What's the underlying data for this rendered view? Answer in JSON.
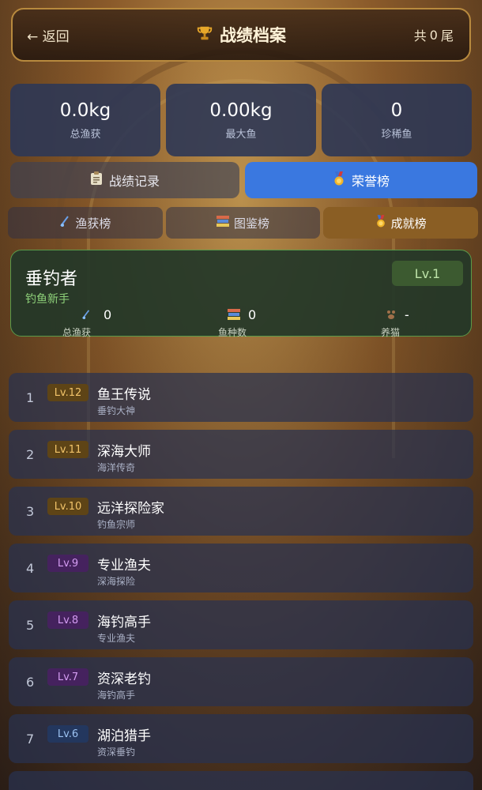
{
  "header": {
    "back_label": "← 返回",
    "title": "战绩档案",
    "count_prefix": "共",
    "count_value": "0",
    "count_suffix": "尾"
  },
  "stats": [
    {
      "value": "0.0kg",
      "label": "总渔获"
    },
    {
      "value": "0.00kg",
      "label": "最大鱼"
    },
    {
      "value": "0",
      "label": "珍稀鱼"
    }
  ],
  "main_tabs": [
    {
      "label": "战绩记录",
      "active": false
    },
    {
      "label": "荣誉榜",
      "active": true
    }
  ],
  "sub_tabs": [
    {
      "label": "渔获榜",
      "active": false
    },
    {
      "label": "图鉴榜",
      "active": false
    },
    {
      "label": "成就榜",
      "active": true
    }
  ],
  "my_card": {
    "name": "垂钓者",
    "rank": "钓鱼新手",
    "level": "Lv.1",
    "stats": [
      {
        "value": "0",
        "label": "总渔获"
      },
      {
        "value": "0",
        "label": "鱼种数"
      },
      {
        "value": "-",
        "label": "养猫"
      }
    ]
  },
  "leaderboard": [
    {
      "index": "1",
      "level": "Lv.12",
      "title": "鱼王传说",
      "prev": "垂钓大神",
      "tier": "gold"
    },
    {
      "index": "2",
      "level": "Lv.11",
      "title": "深海大师",
      "prev": "海洋传奇",
      "tier": "gold"
    },
    {
      "index": "3",
      "level": "Lv.10",
      "title": "远洋探险家",
      "prev": "钓鱼宗师",
      "tier": "gold"
    },
    {
      "index": "4",
      "level": "Lv.9",
      "title": "专业渔夫",
      "prev": "深海探险",
      "tier": "purple"
    },
    {
      "index": "5",
      "level": "Lv.8",
      "title": "海钓高手",
      "prev": "专业渔夫",
      "tier": "purple"
    },
    {
      "index": "6",
      "level": "Lv.7",
      "title": "资深老钓",
      "prev": "海钓高手",
      "tier": "purple"
    },
    {
      "index": "7",
      "level": "Lv.6",
      "title": "湖泊猎手",
      "prev": "资深垂钓",
      "tier": "blue"
    }
  ],
  "colors": {
    "active_tab": "#3a78e0",
    "active_subtab": "#8a5e24",
    "my_card_accent": "#8fd27a"
  }
}
